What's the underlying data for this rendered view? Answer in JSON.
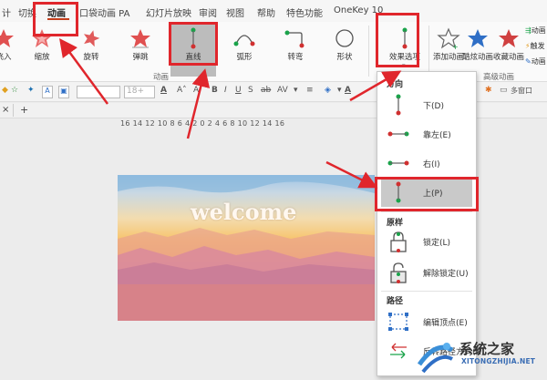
{
  "menu_tabs": [
    "切换",
    "动画",
    "口袋动画 PA",
    "幻灯片放映",
    "审阅",
    "视图",
    "帮助",
    "特色功能",
    "OneKey 10"
  ],
  "ribbon": {
    "buttons_left": [
      "飞入",
      "缩放",
      "旋转",
      "弹跳"
    ],
    "motion_paths": [
      "直线",
      "弧形",
      "转弯",
      "形状"
    ],
    "effect_options": "效果选项",
    "add_animation": "添加动画",
    "cool_animation": "酷炫动画",
    "favorite_animation": "收藏动画",
    "group_animation": "动画",
    "group_advanced": "高级动画",
    "right_items": [
      "动画",
      "触发",
      "动画"
    ]
  },
  "format_toolbar": {
    "font_size": "18+",
    "text_a": "A",
    "text_av": "AV"
  },
  "doc_row": {
    "close": "×",
    "add": "+",
    "window": "多窗口"
  },
  "ruler_text": "16 14 12 10 8 6 4 2 0 2 4 6 8 10 12 14 16",
  "slide": {
    "title": "welcome"
  },
  "dropdown": {
    "direction_header": "方向",
    "directions": [
      "下(D)",
      "靠左(E)",
      "右(I)",
      "上(P)"
    ],
    "selected_direction": "上(P)",
    "origin_header": "原样",
    "origin_items": [
      "锁定(L)",
      "解除锁定(U)"
    ],
    "path_header": "路径",
    "path_items": [
      "编辑顶点(E)",
      "反转路径方向(R)"
    ]
  },
  "watermark": {
    "title": "系统之家",
    "url": "XITONGZHIJIA.NET"
  },
  "colors": {
    "highlight": "#e0262c",
    "accent_red": "#c43e1c",
    "path_green": "#1aa34a",
    "path_red": "#d03030",
    "star_red": "#e05050",
    "star_blue": "#2f6fc6"
  }
}
